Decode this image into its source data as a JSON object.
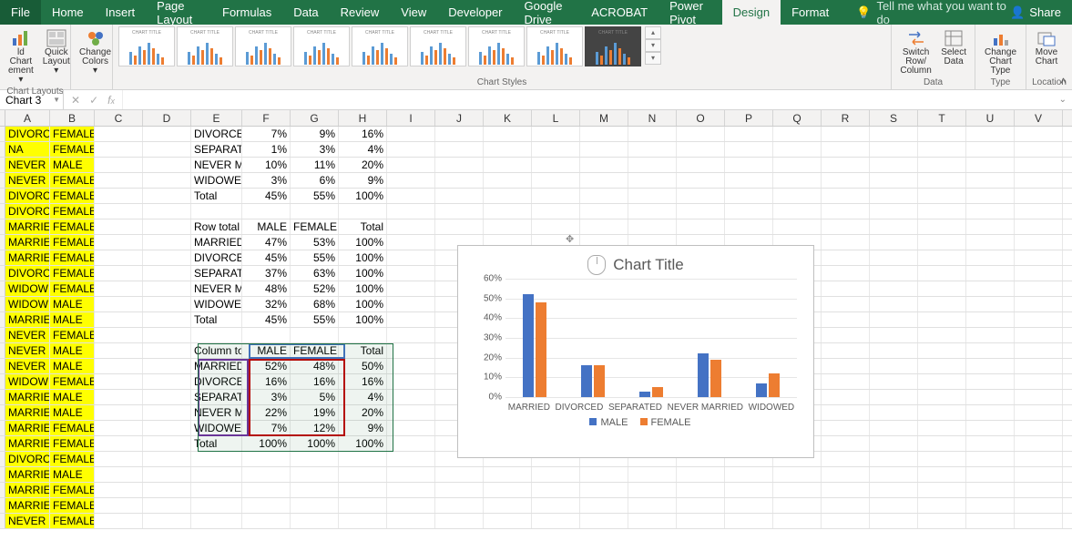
{
  "titlebar": {
    "tabs": [
      "File",
      "Home",
      "Insert",
      "Page Layout",
      "Formulas",
      "Data",
      "Review",
      "View",
      "Developer",
      "Google Drive",
      "ACROBAT",
      "Power Pivot",
      "Design",
      "Format"
    ],
    "active_tab": "Design",
    "tell_me": "Tell me what you want to do",
    "share": "Share"
  },
  "ribbon": {
    "chart_layouts": {
      "add_element": "Add Chart Element",
      "quick_layout": "Quick Layout",
      "label": "Chart Layouts"
    },
    "colors": {
      "change_colors": "Change Colors"
    },
    "styles_label": "Chart Styles",
    "data": {
      "switch": "Switch Row/ Column",
      "select": "Select Data",
      "label": "Data"
    },
    "type": {
      "change": "Change Chart Type",
      "label": "Type"
    },
    "location": {
      "move": "Move Chart",
      "label": "Location"
    }
  },
  "name_box": "Chart 3",
  "col_headers": [
    "A",
    "B",
    "C",
    "D",
    "E",
    "F",
    "G",
    "H",
    "I",
    "J",
    "K",
    "L",
    "M",
    "N",
    "O",
    "P",
    "Q",
    "R",
    "S",
    "T",
    "U",
    "V"
  ],
  "left_rows": [
    [
      "DIVORCED",
      "FEMALE"
    ],
    [
      "NA",
      "FEMALE"
    ],
    [
      "NEVER MA",
      "MALE"
    ],
    [
      "NEVER MA",
      "FEMALE"
    ],
    [
      "DIVORCED",
      "FEMALE"
    ],
    [
      "DIVORCED",
      "FEMALE"
    ],
    [
      "MARRIED",
      "FEMALE"
    ],
    [
      "MARRIED",
      "FEMALE"
    ],
    [
      "MARRIED",
      "FEMALE"
    ],
    [
      "DIVORCED",
      "FEMALE"
    ],
    [
      "WIDOWED",
      "FEMALE"
    ],
    [
      "WIDOWED",
      "MALE"
    ],
    [
      "MARRIED",
      "MALE"
    ],
    [
      "NEVER MA",
      "FEMALE"
    ],
    [
      "NEVER MA",
      "MALE"
    ],
    [
      "NEVER MA",
      "MALE"
    ],
    [
      "WIDOWED",
      "FEMALE"
    ],
    [
      "MARRIED",
      "MALE"
    ],
    [
      "MARRIED",
      "MALE"
    ],
    [
      "MARRIED",
      "FEMALE"
    ],
    [
      "MARRIED",
      "FEMALE"
    ],
    [
      "DIVORCED",
      "FEMALE"
    ],
    [
      "MARRIED",
      "MALE"
    ],
    [
      "MARRIED",
      "FEMALE"
    ],
    [
      "MARRIED",
      "FEMALE"
    ],
    [
      "NEVER MA",
      "FEMALE"
    ]
  ],
  "block1": [
    [
      "DIVORCED",
      "7%",
      "9%",
      "16%"
    ],
    [
      "SEPARATE",
      "1%",
      "3%",
      "4%"
    ],
    [
      "NEVER MA",
      "10%",
      "11%",
      "20%"
    ],
    [
      "WIDOWED",
      "3%",
      "6%",
      "9%"
    ],
    [
      "Total",
      "45%",
      "55%",
      "100%"
    ]
  ],
  "block2_header": [
    "Row total",
    "MALE",
    "FEMALE",
    "Total"
  ],
  "block2": [
    [
      "MARRIED",
      "47%",
      "53%",
      "100%"
    ],
    [
      "DIVORCED",
      "45%",
      "55%",
      "100%"
    ],
    [
      "SEPARATE",
      "37%",
      "63%",
      "100%"
    ],
    [
      "NEVER MA",
      "48%",
      "52%",
      "100%"
    ],
    [
      "WIDOWED",
      "32%",
      "68%",
      "100%"
    ],
    [
      "Total",
      "45%",
      "55%",
      "100%"
    ]
  ],
  "block3_header": [
    "Column to",
    "MALE",
    "FEMALE",
    "Total"
  ],
  "block3": [
    [
      "MARRIED",
      "52%",
      "48%",
      "50%"
    ],
    [
      "DIVORCED",
      "16%",
      "16%",
      "16%"
    ],
    [
      "SEPARATE",
      "3%",
      "5%",
      "4%"
    ],
    [
      "NEVER MA",
      "22%",
      "19%",
      "20%"
    ],
    [
      "WIDOWED",
      "7%",
      "12%",
      "9%"
    ],
    [
      "Total",
      "100%",
      "100%",
      "100%"
    ]
  ],
  "chart_data": {
    "type": "bar",
    "title": "Chart Title",
    "categories": [
      "MARRIED",
      "DIVORCED",
      "SEPARATED",
      "NEVER MARRIED",
      "WIDOWED"
    ],
    "series": [
      {
        "name": "MALE",
        "values": [
          52,
          16,
          3,
          22,
          7
        ]
      },
      {
        "name": "FEMALE",
        "values": [
          48,
          16,
          5,
          19,
          12
        ]
      }
    ],
    "y_ticks": [
      "0%",
      "10%",
      "20%",
      "30%",
      "40%",
      "50%",
      "60%"
    ],
    "ymax": 60,
    "legend": [
      "MALE",
      "FEMALE"
    ]
  }
}
